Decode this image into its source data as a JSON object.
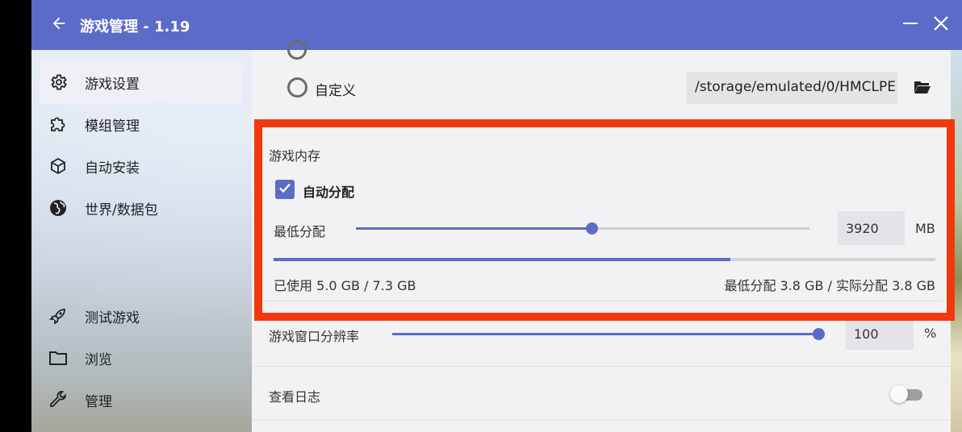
{
  "window": {
    "title": "游戏管理 - 1.19",
    "accent_color": "#5c6bc8",
    "highlight_color": "#f2380f"
  },
  "sidebar": {
    "items": [
      {
        "label": "游戏设置",
        "icon": "gear-icon",
        "active": true
      },
      {
        "label": "模组管理",
        "icon": "puzzle-icon",
        "active": false
      },
      {
        "label": "自动安装",
        "icon": "cube-icon",
        "active": false
      },
      {
        "label": "世界/数据包",
        "icon": "globe-icon",
        "active": false
      },
      {
        "label": "测试游戏",
        "icon": "rocket-icon",
        "active": false
      },
      {
        "label": "浏览",
        "icon": "folder-icon",
        "active": false
      },
      {
        "label": "管理",
        "icon": "wrench-icon",
        "active": false
      }
    ]
  },
  "directory": {
    "custom_label": "自定义",
    "custom_path": "/storage/emulated/0/HMCLPE"
  },
  "memory": {
    "section_label": "游戏内存",
    "auto_allocate_label": "自动分配",
    "auto_allocate_checked": true,
    "min_label": "最低分配",
    "min_value": "3920",
    "min_unit": "MB",
    "min_slider_fraction": 0.52,
    "usage_fraction": 0.69,
    "used_text": "已使用 5.0 GB / 7.3 GB",
    "allocation_text": "最低分配 3.8 GB / 实际分配 3.8 GB"
  },
  "resolution": {
    "label": "游戏窗口分辨率",
    "value": "100",
    "unit": "%",
    "slider_fraction": 1.0
  },
  "log": {
    "label": "查看日志",
    "enabled": false
  }
}
